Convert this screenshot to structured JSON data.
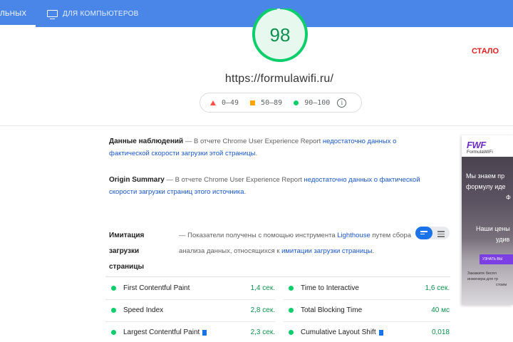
{
  "tabs": {
    "mobile": "ЛЬНЫХ",
    "desktop": "ДЛЯ КОМПЬЮТЕРОВ"
  },
  "score": {
    "value": "98",
    "fill_fraction": 0.98,
    "color": "#0cce6b"
  },
  "annotation": "СТАЛО",
  "url": "https://formulawifi.ru/",
  "legend": {
    "red_range": "0–49",
    "orange_range": "50–89",
    "green_range": "90–100",
    "info_glyph": "i"
  },
  "field_data": {
    "title": "Данные наблюдений",
    "dash": " — В отчете Chrome User Experience Report ",
    "link": "недостаточно данных о фактической скорости загрузки этой страницы",
    "end": "."
  },
  "origin_summary": {
    "title": "Origin Summary",
    "dash": " — В отчете Chrome User Experience Report ",
    "link": "недостаточно данных о фактической скорости загрузки страниц этого источника",
    "end": "."
  },
  "lab": {
    "title_line1": "Имитация",
    "title_line2": "загрузки",
    "title_line3": "страницы",
    "desc_part1": "— Показатели получены с помощью инструмента ",
    "desc_link1": "Lighthouse",
    "desc_part2": " путем сбора анализа данных, относящихся к ",
    "desc_link2": "имитации загрузки страницы",
    "desc_end": "."
  },
  "metrics": [
    {
      "name": "First Contentful Paint",
      "value": "1,4 сек.",
      "flag": false
    },
    {
      "name": "Time to Interactive",
      "value": "1,6 сек.",
      "flag": false
    },
    {
      "name": "Speed Index",
      "value": "2,8 сек.",
      "flag": false
    },
    {
      "name": "Total Blocking Time",
      "value": "40 мс",
      "flag": false
    },
    {
      "name": "Largest Contentful Paint",
      "value": "2,3 сек.",
      "flag": true
    },
    {
      "name": "Cumulative Layout Shift",
      "value": "0,018",
      "flag": true
    }
  ],
  "ad": {
    "logo": "FWF",
    "brand": "FormulaWiFi",
    "line1": "Мы знаем пр",
    "line2": "формулу иде",
    "line3": "Ф",
    "line4": "Наши цены",
    "line5": "удив",
    "button": "УЗНАТЬ ВЫ",
    "small1": "Закажите беспл",
    "small2": "инженера для тр",
    "small3": "стоим"
  },
  "colors": {
    "tab_bar": "#4a86e8",
    "pass": "#0cce6b",
    "average": "#ffa400",
    "fail": "#ff4e42",
    "link": "#1a56c7"
  }
}
